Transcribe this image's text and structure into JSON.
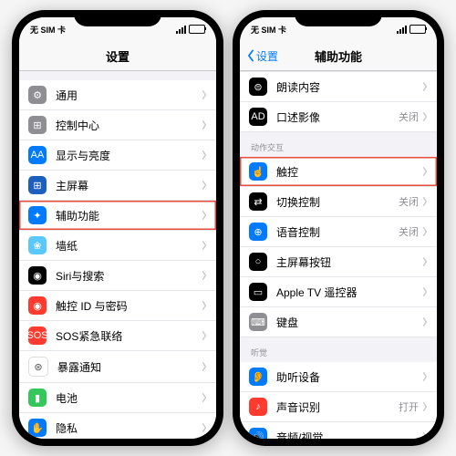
{
  "status": {
    "carrier": "SIM卡",
    "no_sim": "无 SIM 卡"
  },
  "left": {
    "title": "设置",
    "rows": [
      {
        "label": "通用",
        "icon": "gear-icon",
        "cls": "gray"
      },
      {
        "label": "控制中心",
        "icon": "sliders-icon",
        "cls": "gray"
      },
      {
        "label": "显示与亮度",
        "icon": "aa-icon",
        "cls": "blue"
      },
      {
        "label": "主屏幕",
        "icon": "home-icon",
        "cls": "darkblue"
      },
      {
        "label": "辅助功能",
        "icon": "accessibility-icon",
        "cls": "blue",
        "highlight": true
      },
      {
        "label": "墙纸",
        "icon": "wallpaper-icon",
        "cls": "lightblue"
      },
      {
        "label": "Siri与搜索",
        "icon": "siri-icon",
        "cls": "black"
      },
      {
        "label": "触控 ID 与密码",
        "icon": "touchid-icon",
        "cls": "redicon"
      },
      {
        "label": "SOS紧急联络",
        "icon": "sos-icon",
        "cls": "red"
      },
      {
        "label": "暴露通知",
        "icon": "exposure-icon",
        "cls": "white-ic"
      },
      {
        "label": "电池",
        "icon": "battery-icon",
        "cls": "green"
      },
      {
        "label": "隐私",
        "icon": "privacy-icon",
        "cls": "blue"
      }
    ]
  },
  "right": {
    "back": "设置",
    "title": "辅助功能",
    "rows_top": [
      {
        "label": "朗读内容",
        "icon": "speak-icon",
        "cls": "black"
      },
      {
        "label": "口述影像",
        "icon": "ad-icon",
        "cls": "black",
        "value": "关闭"
      }
    ],
    "section1": "动作交互",
    "rows_mid": [
      {
        "label": "触控",
        "icon": "touch-icon",
        "cls": "blue",
        "highlight": true
      },
      {
        "label": "切换控制",
        "icon": "switch-icon",
        "cls": "black",
        "value": "关闭"
      },
      {
        "label": "语音控制",
        "icon": "voice-icon",
        "cls": "blue",
        "value": "关闭"
      },
      {
        "label": "主屏幕按钮",
        "icon": "homebutton-icon",
        "cls": "black"
      },
      {
        "label": "Apple TV 遥控器",
        "icon": "remote-icon",
        "cls": "black"
      },
      {
        "label": "键盘",
        "icon": "keyboard-icon",
        "cls": "gray"
      }
    ],
    "section2": "听觉",
    "rows_bot": [
      {
        "label": "助听设备",
        "icon": "hearing-icon",
        "cls": "blue"
      },
      {
        "label": "声音识别",
        "icon": "sound-icon",
        "cls": "red",
        "value": "打开"
      },
      {
        "label": "音频/视觉",
        "icon": "audio-icon",
        "cls": "blue"
      }
    ]
  }
}
